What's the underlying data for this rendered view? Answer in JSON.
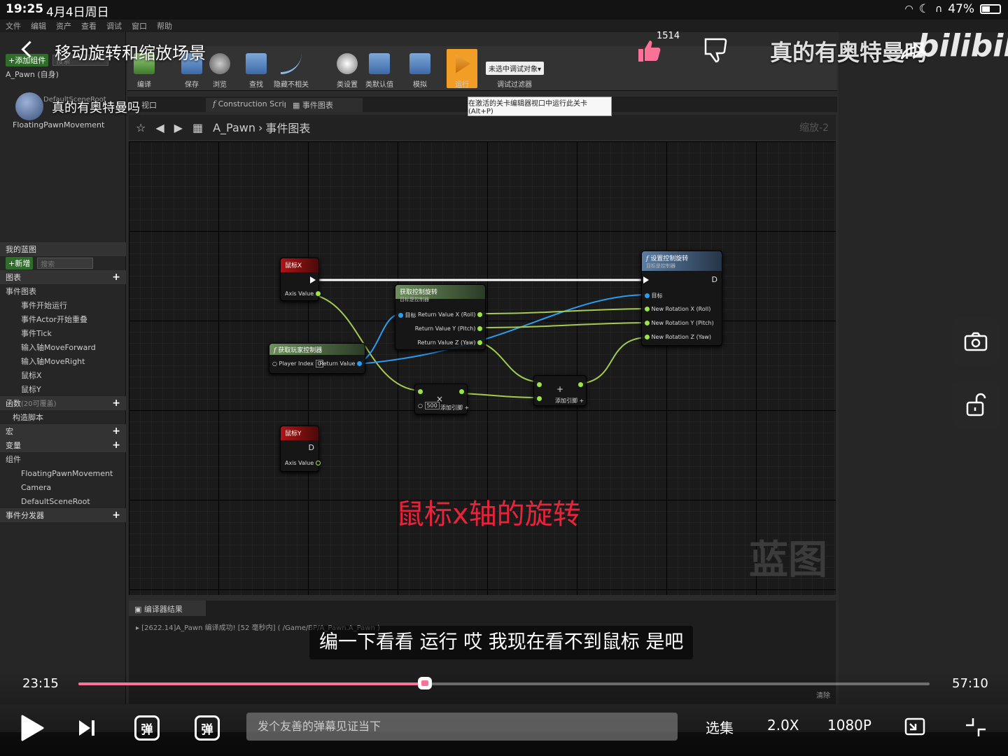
{
  "status_bar": {
    "time": "19:25",
    "date": "4月4日周日",
    "battery": "47%",
    "battery_fraction": 0.47
  },
  "player": {
    "title": "移动旋转和缩放场景",
    "uploader": "真的有奥特曼吗",
    "like_count": "1514",
    "channel_watermark": "真的有奥特曼吗",
    "logo": "bilibili",
    "subtitle": "编一下看看 运行 哎 我现在看不到鼠标 是吧",
    "current_time": "23:15",
    "duration": "57:10",
    "progress_fraction": 0.407,
    "danmaku_placeholder": "发个友善的弹幕见证当下",
    "danmaku_toggle": "弹",
    "danmaku_settings": "弹",
    "episodes_label": "选集",
    "speed_label": "2.0X",
    "quality_label": "1080P",
    "accent_color": "#fb7299"
  },
  "editor": {
    "menu": [
      "文件",
      "编辑",
      "资产",
      "查看",
      "调试",
      "窗口",
      "帮助"
    ],
    "components_panel": {
      "add_button": "+添加组件",
      "search_placeholder": "搜索",
      "self_item": "A_Pawn (自身)",
      "scene_root": "DefaultSceneRoot",
      "camera": "Camera",
      "movement": "FloatingPawnMovement"
    },
    "my_blueprint": {
      "title": "我的蓝图",
      "add_button": "+新增",
      "search_placeholder": "搜索",
      "graphs_header": "图表",
      "event_graph": "事件图表",
      "events": [
        "事件开始运行",
        "事件Actor开始重叠",
        "事件Tick",
        "输入轴MoveForward",
        "输入轴MoveRight",
        "鼠标X",
        "鼠标Y"
      ],
      "functions_header": "函数",
      "functions_count": "(20可覆盖)",
      "construction": "构造脚本",
      "macros_header": "宏",
      "variables_header": "变量",
      "components_header": "组件",
      "components": [
        "FloatingPawnMovement",
        "Camera",
        "DefaultSceneRoot"
      ],
      "dispatchers_header": "事件分发器"
    },
    "toolbar": {
      "compile": "编译",
      "save": "保存",
      "browse": "浏览",
      "find": "查找",
      "hide_unrelated": "隐藏不相关",
      "class_settings": "类设置",
      "class_defaults": "类默认值",
      "simulate": "模拟",
      "play": "运行",
      "debug_object": "未选中调试对象▾",
      "debug_filter": "调试过滤器",
      "tooltip": "在激活的关卡编辑器视口中运行此关卡 (Alt+P)"
    },
    "tabs": {
      "viewport": "视口",
      "construction": "Construction Scrip",
      "event_graph": "事件图表"
    },
    "breadcrumb": {
      "root": "A_Pawn",
      "sep": "›",
      "current": "事件图表",
      "zoom": "缩放-2"
    },
    "nodes": {
      "mouse_x": {
        "title": "鼠标X",
        "pin": "Axis Value"
      },
      "mouse_y": {
        "title": "鼠标Y",
        "pin": "Axis Value"
      },
      "get_control_rotation": {
        "title": "获取控制旋转",
        "subtitle": "目标是控制器",
        "target": "目标",
        "out_x": "Return Value X (Roll)",
        "out_y": "Return Value Y (Pitch)",
        "out_z": "Return Value Z (Yaw)"
      },
      "get_player_controller": {
        "title": "获取玩家控制器",
        "in": "Player Index",
        "in_value": "0",
        "out": "Return Value"
      },
      "multiply": {
        "symbol": "×",
        "value": "500",
        "add_pin": "添加引脚 +"
      },
      "add": {
        "symbol": "+",
        "add_pin": "添加引脚 +"
      },
      "set_control_rotation": {
        "title": "设置控制旋转",
        "subtitle": "目标是控制器",
        "target": "目标",
        "in_x": "New Rotation X (Roll)",
        "in_y": "New Rotation Y (Pitch)",
        "in_z": "New Rotation Z (Yaw)"
      }
    },
    "graph_caption": "鼠标x轴的旋转",
    "graph_watermark": "蓝图",
    "compiler": {
      "tab": "编译器结果",
      "log": "▸ [2622.14]A_Pawn 编译成功! [52 毫秒内] ( /Game/BP/A_Pawn.A_Pawn )",
      "clear": "清除"
    }
  },
  "colors": {
    "exec_wire": "#ffffff",
    "float_wire": "#a6c94f",
    "object_wire": "#2c9cf0",
    "caption_red": "#e8233a"
  }
}
